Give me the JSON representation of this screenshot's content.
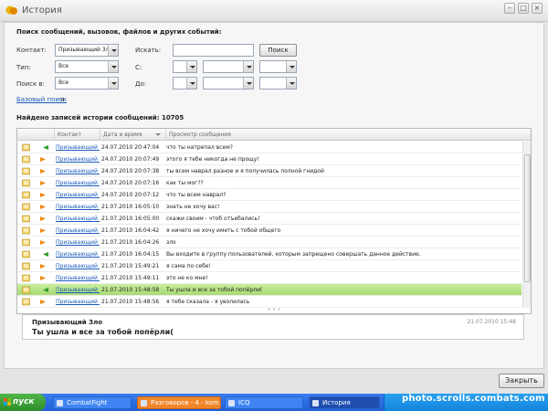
{
  "window": {
    "title": "История"
  },
  "search": {
    "section_title": "Поиск сообщений, вызовов, файлов и других событий:",
    "contact_label": "Контакт:",
    "contact_value": "Призывающий Зло",
    "search_label": "Искать:",
    "search_value": "",
    "search_button": "Поиск",
    "type_label": "Тип:",
    "type_value": "Все",
    "from_label": "С:",
    "searchin_label": "Поиск в:",
    "searchin_value": "Все",
    "to_label": "До:",
    "basic_search_link": "Базовый поиск",
    "basic_search_suffix": "я"
  },
  "results": {
    "found_text": "Найдено записей истории сообщений: 10705"
  },
  "list": {
    "columns": [
      "Контакт",
      "Дата и время",
      "Просмотр сообщения"
    ],
    "rows": [
      {
        "contact": "Призывающий Зло",
        "date": "24.07.2010 20:47:04",
        "message": "что ты натрепал всем?",
        "dir": "in"
      },
      {
        "contact": "Призывающий Зло",
        "date": "24.07.2010 20:07:49",
        "message": "этого я тебе никогда не прощу!",
        "dir": "out"
      },
      {
        "contact": "Призывающий Зло",
        "date": "24.07.2010 20:07:38",
        "message": "ты всем наврал разное и я получилась полной гнидой",
        "dir": "out"
      },
      {
        "contact": "Призывающий Зло",
        "date": "24.07.2010 20:07:16",
        "message": "как ты мог??",
        "dir": "out"
      },
      {
        "contact": "Призывающий Зло",
        "date": "24.07.2010 20:07:12",
        "message": "что ты всем наврал?",
        "dir": "out"
      },
      {
        "contact": "Призывающий Зло",
        "date": "21.07.2010 16:05:10",
        "message": "знать не хочу вас!",
        "dir": "out"
      },
      {
        "contact": "Призывающий Зло",
        "date": "21.07.2010 16:05:00",
        "message": "скажи своим - чтоб отъебались!",
        "dir": "out"
      },
      {
        "contact": "Призывающий Зло",
        "date": "21.07.2010 16:04:42",
        "message": "я ничего не хочу иметь с тобой общего",
        "dir": "out"
      },
      {
        "contact": "Призывающий Зло",
        "date": "21.07.2010 16:04:26",
        "message": "зло",
        "dir": "out"
      },
      {
        "contact": "Призывающий Зло",
        "date": "21.07.2010 16:04:15",
        "message": "Вы входите в группу пользователей, которым запрещено совершать данное действие.",
        "dir": "in"
      },
      {
        "contact": "Призывающий Зло",
        "date": "21.07.2010 15:49:21",
        "message": "я сама по себе!",
        "dir": "out"
      },
      {
        "contact": "Призывающий Зло",
        "date": "21.07.2010 15:49:11",
        "message": "это не ко мне!",
        "dir": "out"
      },
      {
        "contact": "Призывающий Зло",
        "date": "21.07.2010 15:48:58",
        "message": "Ты ушла и все за тобой попёрли(",
        "dir": "in",
        "selected": true
      },
      {
        "contact": "Призывающий Зло",
        "date": "21.07.2010 15:48:56",
        "message": "я тебе сказала - я уволилась",
        "dir": "out"
      }
    ]
  },
  "preview": {
    "sender": "Призывающий Зло",
    "date": "21.07.2010 15:48",
    "text": "Ты ушла и все за тобой попёрли("
  },
  "footer": {
    "close_button": "Закрыть"
  },
  "taskbar": {
    "start": "пуск",
    "tasks": [
      "CombatFight",
      "Разговоров - 4 - kom...",
      "ICQ",
      "История"
    ],
    "watermark": "photo.scrolls.combats.com"
  },
  "colors": {
    "selected_row": "#b4e285",
    "link": "#1c5bbd",
    "arrow_in": "#2d9b2d",
    "arrow_out": "#f08a18"
  }
}
